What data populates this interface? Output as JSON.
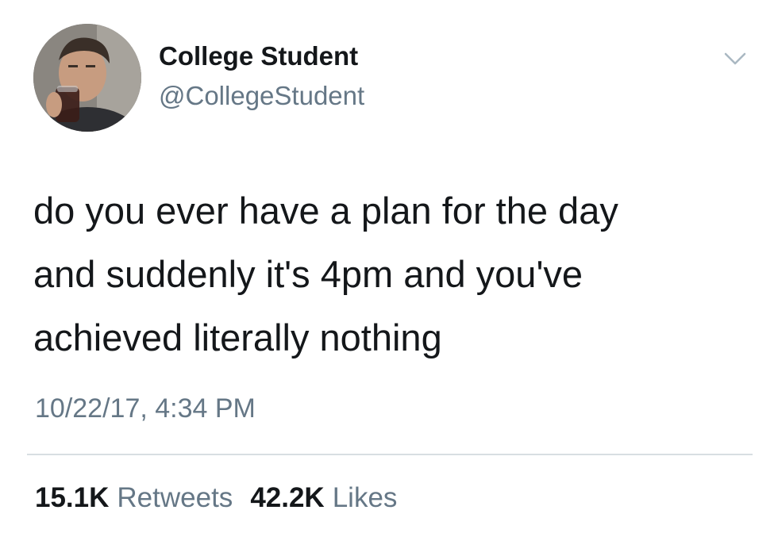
{
  "tweet": {
    "author": {
      "name": "College Student",
      "handle": "@CollegeStudent",
      "avatar_icon": "profile-photo"
    },
    "text": "do you ever have a plan for the day\nand suddenly it's 4pm and you've\nachieved literally nothing",
    "timestamp": "10/22/17, 4:34 PM",
    "stats": {
      "retweets_count": "15.1K",
      "retweets_label": "Retweets",
      "likes_count": "42.2K",
      "likes_label": "Likes"
    },
    "menu_icon": "chevron-down-icon"
  },
  "colors": {
    "text_primary": "#14171a",
    "text_secondary": "#657786",
    "divider": "#d8dee2",
    "background": "#ffffff"
  }
}
